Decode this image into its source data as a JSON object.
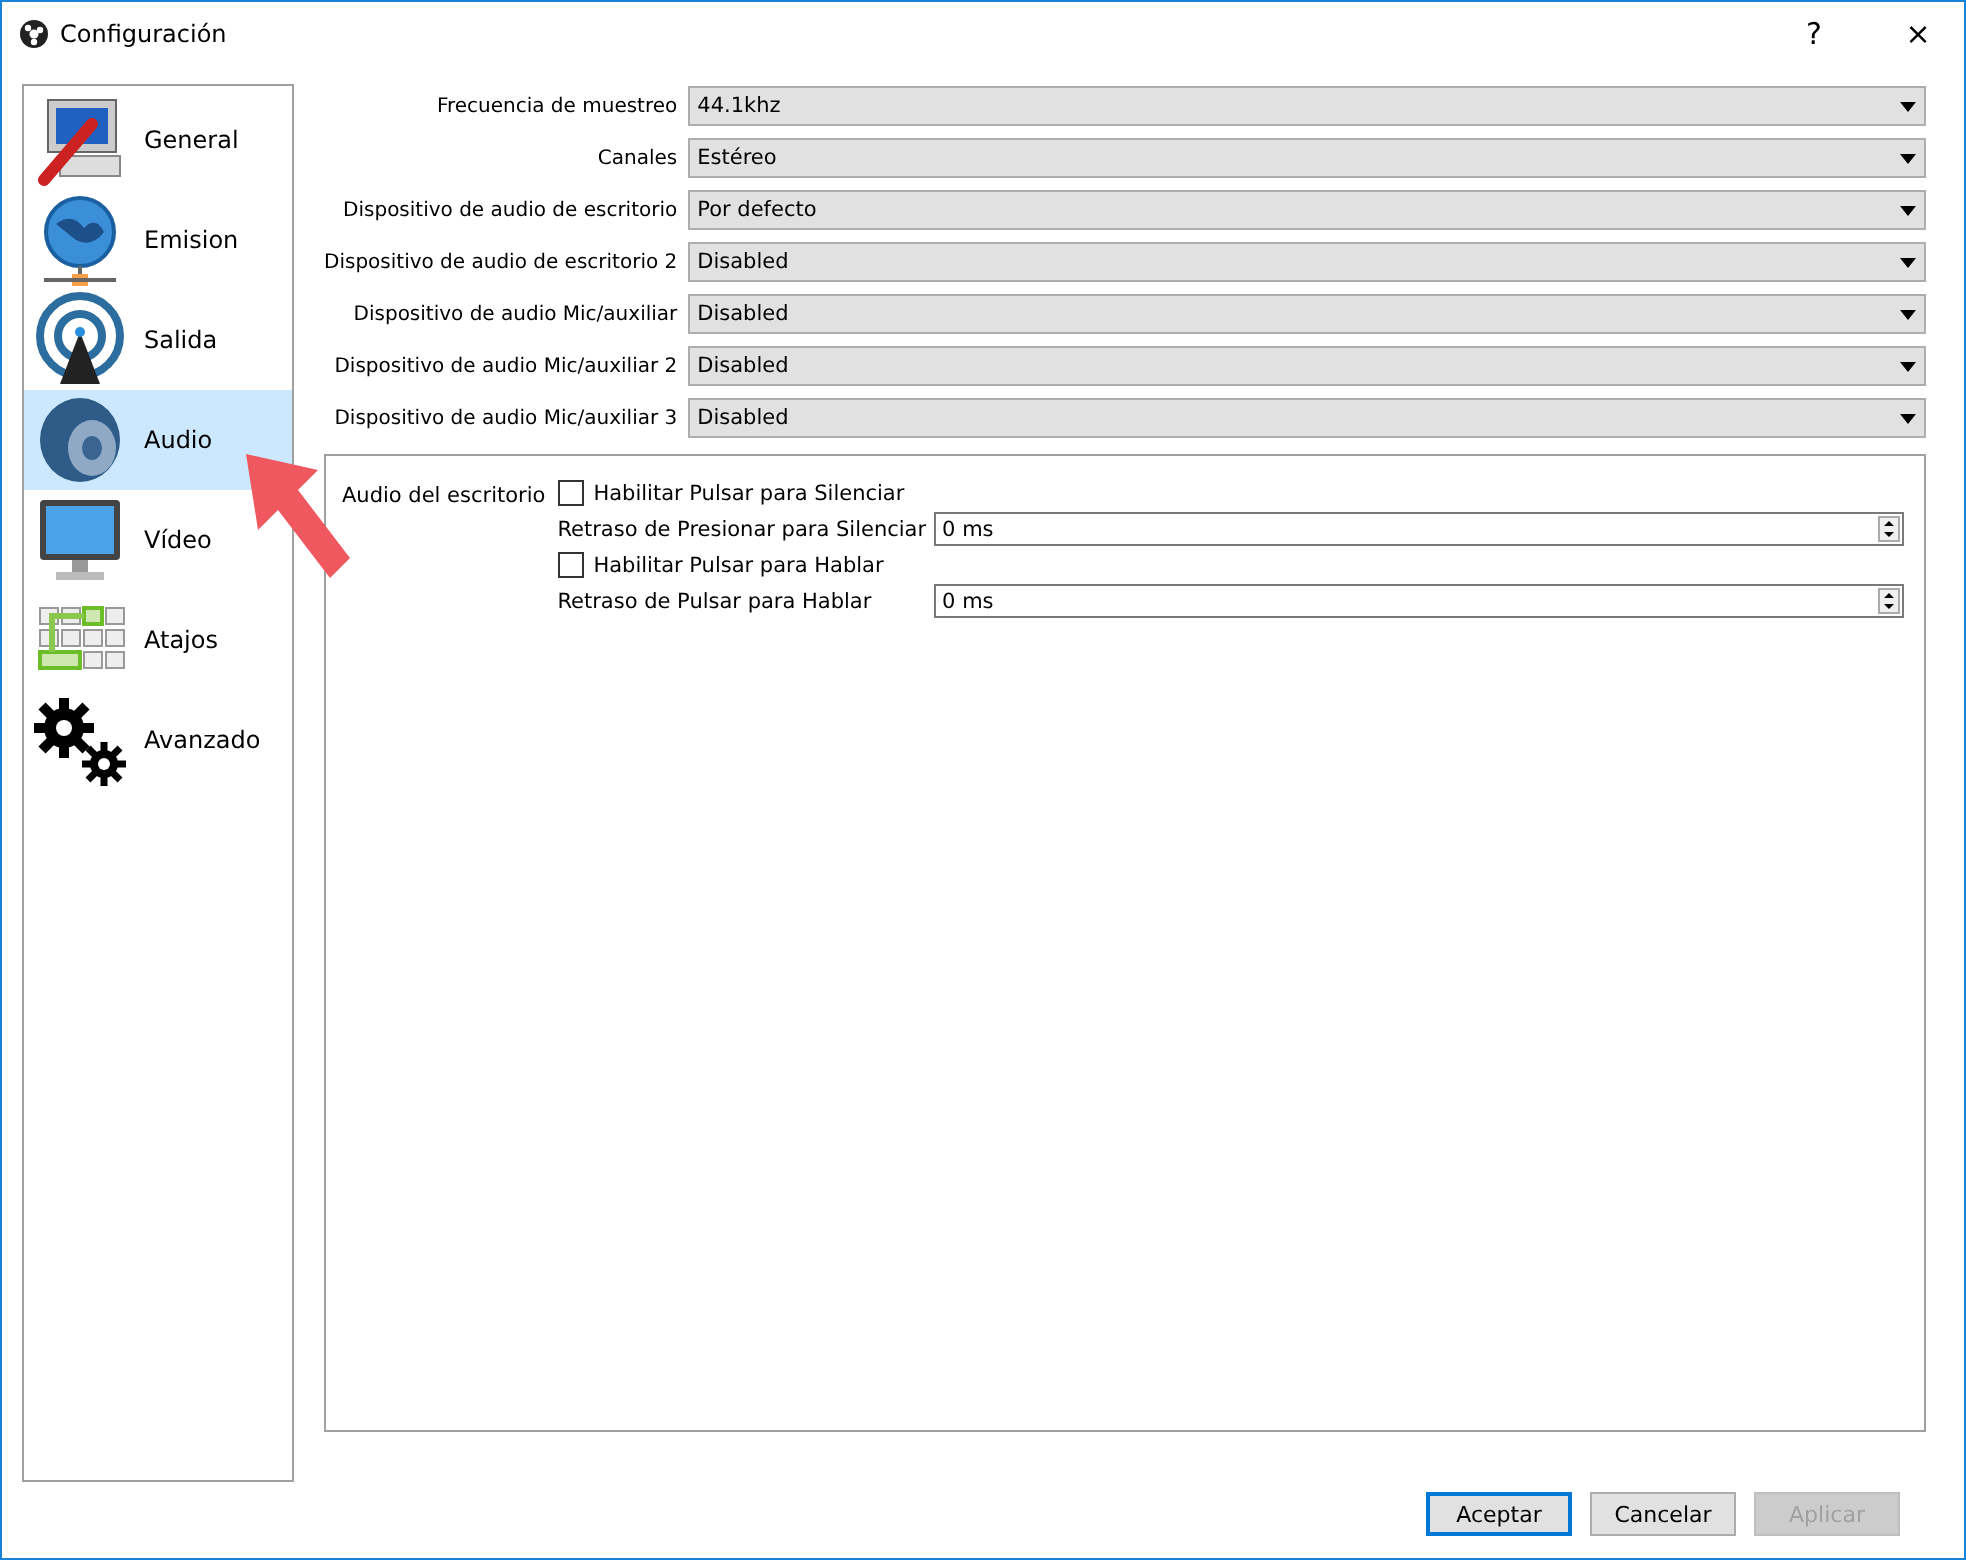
{
  "window": {
    "title": "Configuración",
    "help": "?",
    "close": "×"
  },
  "sidebar": {
    "items": [
      {
        "label": "General",
        "selected": false
      },
      {
        "label": "Emision",
        "selected": false
      },
      {
        "label": "Salida",
        "selected": false
      },
      {
        "label": "Audio",
        "selected": true
      },
      {
        "label": "Vídeo",
        "selected": false
      },
      {
        "label": "Atajos",
        "selected": false
      },
      {
        "label": "Avanzado",
        "selected": false
      }
    ]
  },
  "settings": [
    {
      "label": "Frecuencia de muestreo",
      "value": "44.1khz"
    },
    {
      "label": "Canales",
      "value": "Estéreo"
    },
    {
      "label": "Dispositivo de audio de escritorio",
      "value": "Por defecto"
    },
    {
      "label": "Dispositivo de audio de escritorio 2",
      "value": "Disabled"
    },
    {
      "label": "Dispositivo de audio Mic/auxiliar",
      "value": "Disabled"
    },
    {
      "label": "Dispositivo de audio Mic/auxiliar 2",
      "value": "Disabled"
    },
    {
      "label": "Dispositivo de audio Mic/auxiliar 3",
      "value": "Disabled"
    }
  ],
  "group": {
    "title": "Audio del escritorio",
    "rows": [
      {
        "kind": "checkbox",
        "label": "Habilitar Pulsar para Silenciar",
        "checked": false
      },
      {
        "kind": "spin",
        "label": "Retraso de Presionar para Silenciar",
        "value": "0 ms"
      },
      {
        "kind": "checkbox",
        "label": "Habilitar Pulsar para Hablar",
        "checked": false
      },
      {
        "kind": "spin",
        "label": "Retraso de Pulsar para Hablar",
        "value": "0 ms"
      }
    ]
  },
  "buttons": [
    {
      "label": "Aceptar",
      "default": true,
      "disabled": false
    },
    {
      "label": "Cancelar",
      "default": false,
      "disabled": false
    },
    {
      "label": "Aplicar",
      "default": false,
      "disabled": true
    }
  ]
}
